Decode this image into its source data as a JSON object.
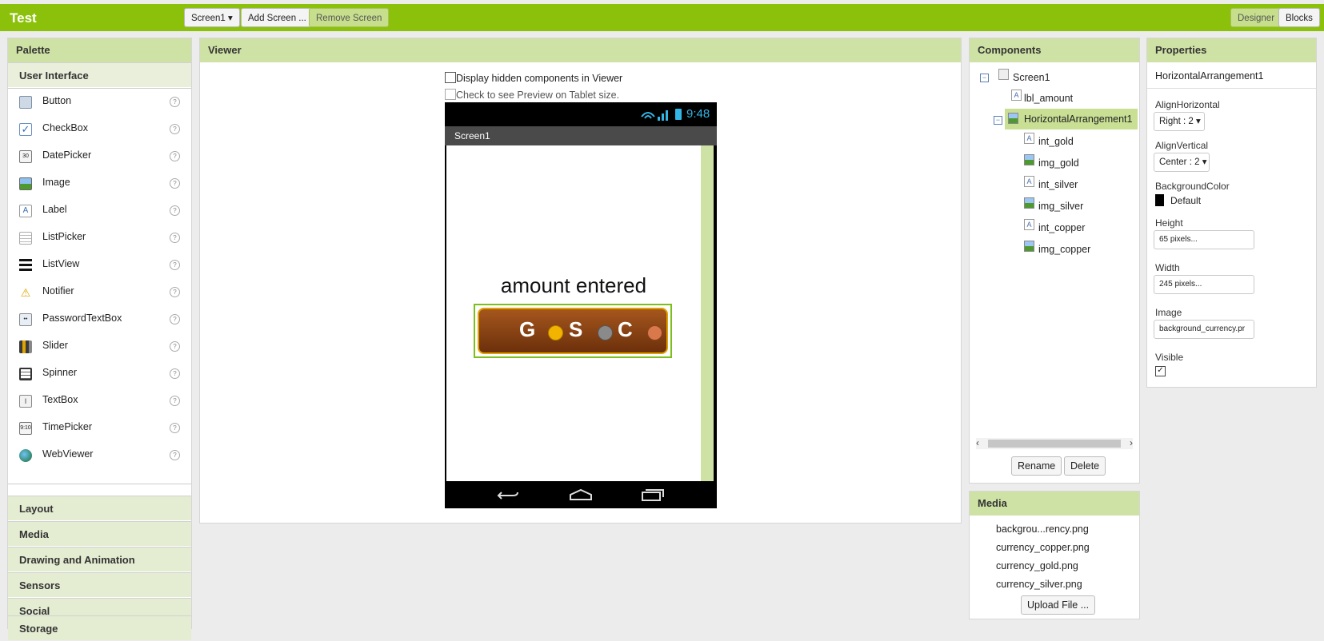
{
  "app_title": "Test",
  "toolbar": {
    "screen_select": "Screen1 ▾",
    "add_screen": "Add Screen ...",
    "remove_screen": "Remove Screen",
    "designer": "Designer",
    "blocks": "Blocks"
  },
  "palette": {
    "title": "Palette",
    "open_category": "User Interface",
    "items": [
      {
        "label": "Button",
        "icon": "button-icon"
      },
      {
        "label": "CheckBox",
        "icon": "checkbox-icon"
      },
      {
        "label": "DatePicker",
        "icon": "datepicker-icon"
      },
      {
        "label": "Image",
        "icon": "image-icon"
      },
      {
        "label": "Label",
        "icon": "label-icon"
      },
      {
        "label": "ListPicker",
        "icon": "listpicker-icon"
      },
      {
        "label": "ListView",
        "icon": "listview-icon"
      },
      {
        "label": "Notifier",
        "icon": "notifier-icon"
      },
      {
        "label": "PasswordTextBox",
        "icon": "passwordtextbox-icon"
      },
      {
        "label": "Slider",
        "icon": "slider-icon"
      },
      {
        "label": "Spinner",
        "icon": "spinner-icon"
      },
      {
        "label": "TextBox",
        "icon": "textbox-icon"
      },
      {
        "label": "TimePicker",
        "icon": "timepicker-icon"
      },
      {
        "label": "WebViewer",
        "icon": "webviewer-icon"
      }
    ],
    "categories": [
      "Layout",
      "Media",
      "Drawing and Animation",
      "Sensors",
      "Social",
      "Storage"
    ]
  },
  "viewer": {
    "title": "Viewer",
    "hidden_components_label": "Display hidden components in Viewer",
    "tablet_preview_label": "Check to see Preview on Tablet size.",
    "phone": {
      "time": "9:48",
      "screen_title": "Screen1",
      "amount_label": "amount entered",
      "currency": {
        "gold": "G",
        "silver": "S",
        "copper": "C"
      }
    }
  },
  "components": {
    "title": "Components",
    "tree": [
      {
        "label": "Screen1",
        "kind": "screen"
      },
      {
        "label": "lbl_amount",
        "kind": "label"
      },
      {
        "label": "HorizontalArrangement1",
        "kind": "arrangement"
      },
      {
        "label": "int_gold",
        "kind": "label"
      },
      {
        "label": "img_gold",
        "kind": "image"
      },
      {
        "label": "int_silver",
        "kind": "label"
      },
      {
        "label": "img_silver",
        "kind": "image"
      },
      {
        "label": "int_copper",
        "kind": "label"
      },
      {
        "label": "img_copper",
        "kind": "image"
      }
    ],
    "rename": "Rename",
    "delete": "Delete"
  },
  "media": {
    "title": "Media",
    "files": [
      "backgrou...rency.png",
      "currency_copper.png",
      "currency_gold.png",
      "currency_silver.png"
    ],
    "upload": "Upload File ..."
  },
  "properties": {
    "title": "Properties",
    "selected": "HorizontalArrangement1",
    "align_horizontal_label": "AlignHorizontal",
    "align_horizontal_value": "Right : 2 ▾",
    "align_vertical_label": "AlignVertical",
    "align_vertical_value": "Center : 2 ▾",
    "background_color_label": "BackgroundColor",
    "background_color_value": "Default",
    "height_label": "Height",
    "height_value": "65 pixels...",
    "width_label": "Width",
    "width_value": "245 pixels...",
    "image_label": "Image",
    "image_value": "background_currency.pr",
    "visible_label": "Visible",
    "visible_checked": true
  },
  "colors": {
    "accent": "#8cc10b",
    "panel_header": "#cfe2a5",
    "currency_bar": "#7a3d12",
    "selection": "#c8df94"
  }
}
